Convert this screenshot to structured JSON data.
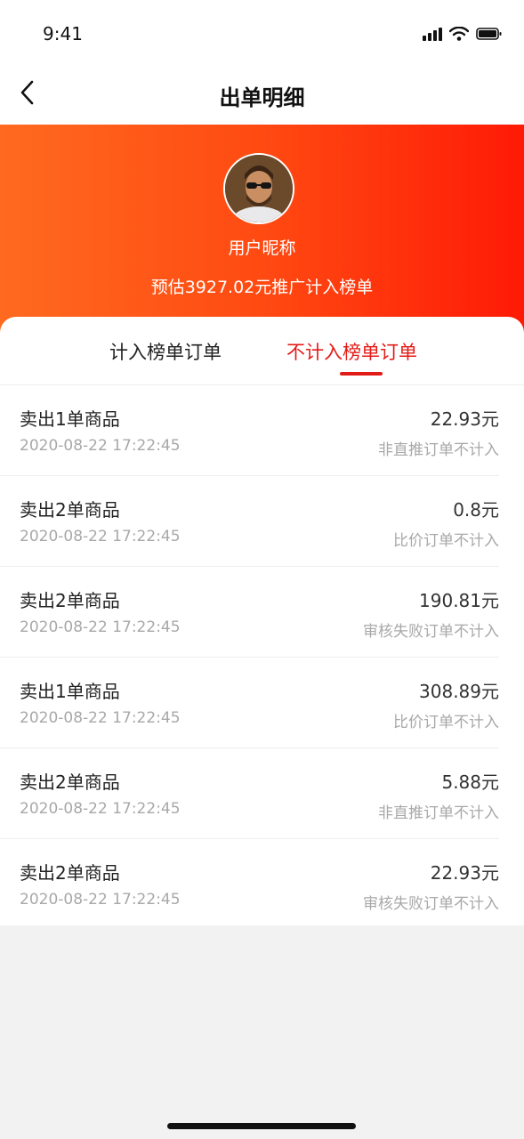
{
  "status_bar": {
    "time": "9:41"
  },
  "nav": {
    "title": "出单明细"
  },
  "profile": {
    "nickname": "用户昵称",
    "estimate_text": "预估3927.02元推广计入榜单"
  },
  "tabs": [
    {
      "label": "计入榜单订单",
      "active": false
    },
    {
      "label": "不计入榜单订单",
      "active": true
    }
  ],
  "orders": [
    {
      "title": "卖出1单商品",
      "time": "2020-08-22 17:22:45",
      "amount": "22.93元",
      "status": "非直推订单不计入"
    },
    {
      "title": "卖出2单商品",
      "time": "2020-08-22 17:22:45",
      "amount": "0.8元",
      "status": "比价订单不计入"
    },
    {
      "title": "卖出2单商品",
      "time": "2020-08-22 17:22:45",
      "amount": "190.81元",
      "status": "审核失败订单不计入"
    },
    {
      "title": "卖出1单商品",
      "time": "2020-08-22 17:22:45",
      "amount": "308.89元",
      "status": "比价订单不计入"
    },
    {
      "title": "卖出2单商品",
      "time": "2020-08-22 17:22:45",
      "amount": "5.88元",
      "status": "非直推订单不计入"
    },
    {
      "title": "卖出2单商品",
      "time": "2020-08-22 17:22:45",
      "amount": "22.93元",
      "status": "审核失败订单不计入"
    }
  ],
  "colors": {
    "accent": "#e31b17",
    "hero_start": "#ff6a1f",
    "hero_end": "#ff1a06"
  },
  "icons": [
    "signal-icon",
    "wifi-icon",
    "battery-icon",
    "back-chevron-icon"
  ]
}
